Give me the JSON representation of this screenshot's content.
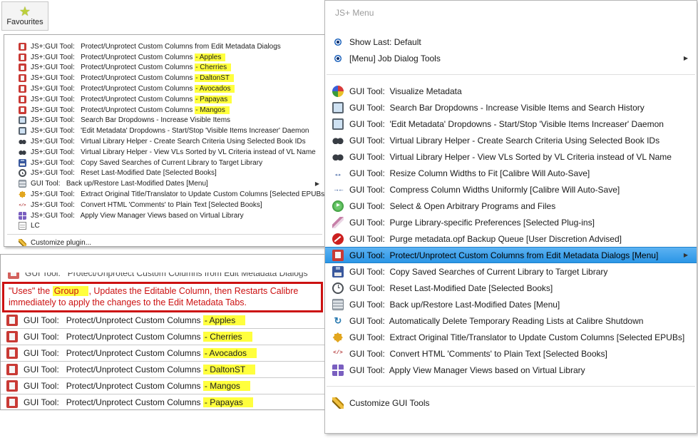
{
  "colors": {
    "highlight_yellow": "#ffff3d",
    "selection_blue": "#2b96e6",
    "note_red": "#cc1111"
  },
  "favourites": {
    "label": "Favourites"
  },
  "top_menu": {
    "items": [
      {
        "icon": "protect",
        "label": "JS+:GUI Tool:   Protect/Unprotect Custom Columns from Edit Metadata Dialogs"
      },
      {
        "icon": "protect",
        "prefix": "JS+:GUI Tool:   Protect/Unprotect Custom Columns ",
        "highlight": "- Apples"
      },
      {
        "icon": "protect",
        "prefix": "JS+:GUI Tool:   Protect/Unprotect Custom Columns ",
        "highlight": "- Cherries"
      },
      {
        "icon": "protect",
        "prefix": "JS+:GUI Tool:   Protect/Unprotect Custom Columns ",
        "highlight": "- DaltonST"
      },
      {
        "icon": "protect",
        "prefix": "JS+:GUI Tool:   Protect/Unprotect Custom Columns ",
        "highlight": "- Avocados"
      },
      {
        "icon": "protect",
        "prefix": "JS+:GUI Tool:   Protect/Unprotect Custom Columns ",
        "highlight": "- Papayas"
      },
      {
        "icon": "protect",
        "prefix": "JS+:GUI Tool:   Protect/Unprotect Custom Columns ",
        "highlight": "- Mangos"
      },
      {
        "icon": "monitor",
        "label": "JS+:GUI Tool:   Search Bar Dropdowns - Increase Visible Items"
      },
      {
        "icon": "monitor",
        "label": "JS+:GUI Tool:   'Edit Metadata' Dropdowns - Start/Stop 'Visible Items Increaser' Daemon"
      },
      {
        "icon": "binoculars",
        "label": "JS+:GUI Tool:   Virtual Library Helper - Create Search Criteria Using Selected Book IDs"
      },
      {
        "icon": "binoculars",
        "label": "JS+:GUI Tool:   Virtual Library Helper - View VLs Sorted by VL Criteria instead of VL Name"
      },
      {
        "icon": "copy",
        "label": "JS+:GUI Tool:   Copy Saved Searches of Current Library to Target Library"
      },
      {
        "icon": "clock",
        "label": "JS+:GUI Tool:   Reset Last-Modified Date [Selected Books]"
      },
      {
        "icon": "disks",
        "label": "GUI Tool:   Back up/Restore Last-Modified Dates [Menu]",
        "submenu": true
      },
      {
        "icon": "star8",
        "label": "JS+:GUI Tool:   Extract Original Title/Translator to Update Custom Columns [Selected EPUBs]"
      },
      {
        "icon": "code",
        "label": "JS+:GUI Tool:   Convert HTML 'Comments' to Plain Text [Selected Books]"
      },
      {
        "icon": "grid",
        "label": "JS+:GUI Tool:   Apply View Manager Views based on Virtual Library"
      },
      {
        "icon": "doc",
        "label": "LC"
      },
      {
        "type": "separator"
      },
      {
        "icon": "pencil",
        "label": "Customize plugin..."
      }
    ]
  },
  "bottom_menu": {
    "clipped_item": {
      "icon": "protect",
      "label": "GUI Tool:   Protect/Unprotect Custom Columns from Edit Metadata Dialogs"
    },
    "note_parts": [
      {
        "text": "\"Uses\" the "
      },
      {
        "text": "Group",
        "highlight": true
      },
      {
        "text": ", Updates the Editable Column, then Restarts Calibre immediately to apply the changes to the Edit Metadata Tabs."
      }
    ],
    "items": [
      {
        "icon": "protect",
        "prefix": "GUI Tool:   Protect/Unprotect Custom Columns ",
        "highlight": "- Apples"
      },
      {
        "icon": "protect",
        "prefix": "GUI Tool:   Protect/Unprotect Custom Columns ",
        "highlight": "- Cherries"
      },
      {
        "icon": "protect",
        "prefix": "GUI Tool:   Protect/Unprotect Custom Columns ",
        "highlight": "- Avocados"
      },
      {
        "icon": "protect",
        "prefix": "GUI Tool:   Protect/Unprotect Custom Columns ",
        "highlight": "- DaltonST"
      },
      {
        "icon": "protect",
        "prefix": "GUI Tool:   Protect/Unprotect Custom Columns ",
        "highlight": "- Mangos"
      },
      {
        "icon": "protect",
        "prefix": "GUI Tool:   Protect/Unprotect Custom Columns ",
        "highlight": "- Papayas"
      }
    ]
  },
  "right_menu": {
    "title": "JS+ Menu",
    "items": [
      {
        "icon": "eye",
        "label": "Show Last: Default"
      },
      {
        "icon": "eye",
        "label": "[Menu] Job Dialog Tools",
        "submenu": true
      },
      {
        "type": "separator"
      },
      {
        "icon": "pie",
        "label": "GUI Tool:  Visualize Metadata"
      },
      {
        "icon": "monitor",
        "label": "GUI Tool:  Search Bar Dropdowns - Increase Visible Items and Search History"
      },
      {
        "icon": "monitor",
        "label": "GUI Tool:  'Edit Metadata' Dropdowns - Start/Stop 'Visible Items Increaser' Daemon"
      },
      {
        "icon": "binoculars",
        "label": "GUI Tool:  Virtual Library Helper - Create Search Criteria Using Selected Book IDs"
      },
      {
        "icon": "binoculars",
        "label": "GUI Tool:  Virtual Library Helper - View VLs Sorted by VL Criteria instead of VL Name"
      },
      {
        "icon": "resize",
        "label": "GUI Tool:  Resize Column Widths to Fit [Calibre Will Auto-Save]"
      },
      {
        "icon": "compress",
        "label": "GUI Tool:  Compress Column Widths Uniformly [Calibre Will Auto-Save]"
      },
      {
        "icon": "play",
        "label": "GUI Tool:  Select & Open Arbitrary Programs and Files"
      },
      {
        "icon": "knife",
        "label": "GUI Tool:  Purge Library-specific Preferences [Selected Plug-ins]"
      },
      {
        "icon": "noentry",
        "label": "GUI Tool:  Purge metadata.opf Backup Queue [User Discretion Advised]"
      },
      {
        "icon": "protect",
        "label": "GUI Tool:  Protect/Unprotect Custom Columns from Edit Metadata Dialogs [Menu]",
        "selected": true,
        "submenu": true
      },
      {
        "icon": "copy",
        "label": "GUI Tool:  Copy Saved Searches of Current Library to Target Library"
      },
      {
        "icon": "clock",
        "label": "GUI Tool:  Reset Last-Modified Date [Selected Books]"
      },
      {
        "icon": "disks",
        "label": "GUI Tool:  Back up/Restore Last-Modified Dates [Menu]"
      },
      {
        "icon": "autodelete",
        "label": "GUI Tool:  Automatically Delete Temporary Reading Lists at Calibre Shutdown"
      },
      {
        "icon": "star8",
        "label": "GUI Tool:  Extract Original Title/Translator to Update Custom Columns [Selected EPUBs]"
      },
      {
        "icon": "code",
        "label": "GUI Tool:  Convert HTML 'Comments' to Plain Text [Selected Books]"
      },
      {
        "icon": "grid",
        "label": "GUI Tool:  Apply View Manager Views based on Virtual Library"
      },
      {
        "type": "separator"
      },
      {
        "icon": "pencil",
        "label": "Customize GUI Tools"
      }
    ]
  }
}
